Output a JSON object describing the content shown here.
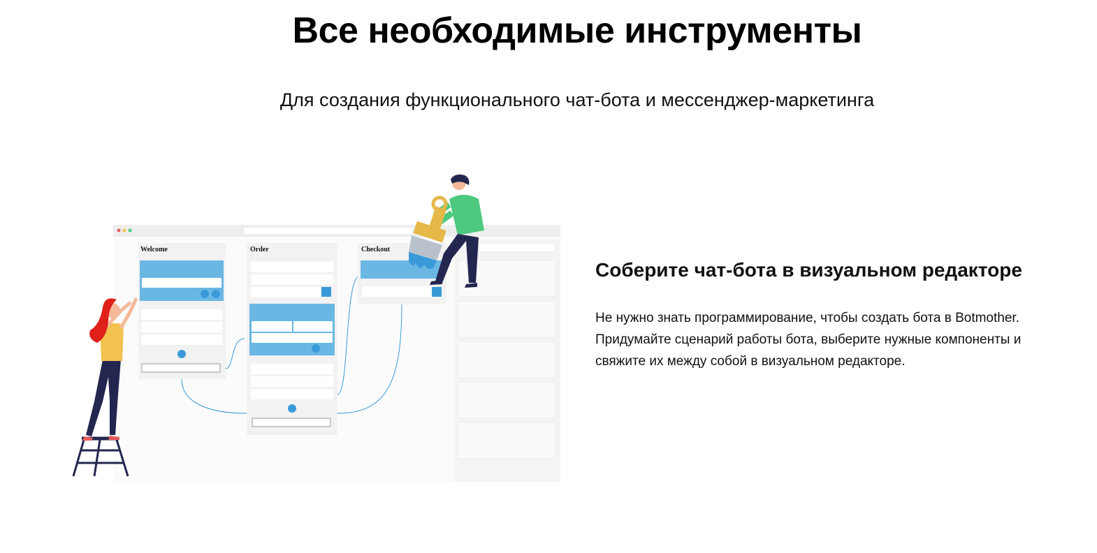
{
  "header": {
    "title": "Все необходимые инструменты",
    "subtitle": "Для создания функционального чат-бота и мессенджер-маркетинга"
  },
  "illustration": {
    "columns": [
      {
        "label": "Welcome"
      },
      {
        "label": "Order"
      },
      {
        "label": "Checkout"
      }
    ],
    "icons": [
      "window-dots-icon",
      "paint-brush-icon",
      "ladder-icon"
    ],
    "colors": {
      "accent_blue": "#6ab7e3",
      "node_blue": "#3a9ad9",
      "panel_gray": "#f2f2f2",
      "woman_hair": "#e0201b",
      "woman_shirt": "#f2c14e",
      "man_shirt": "#4cc97f",
      "navy": "#23264f",
      "brush_gold": "#e6b84a"
    }
  },
  "feature": {
    "title": "Соберите чат-бота в визуальном редакторе",
    "text": "Не нужно знать программирование, чтобы создать бота в Botmother. Придумайте сценарий работы бота, выберите нужные компоненты и свяжите их между собой в визуальном редакторе."
  }
}
